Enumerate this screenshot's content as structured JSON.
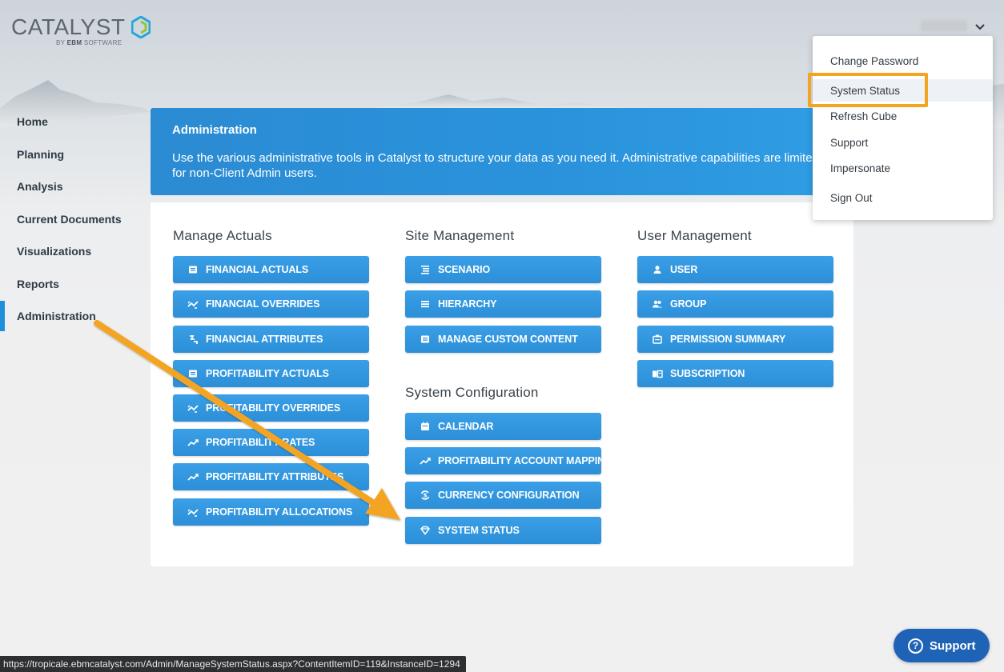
{
  "brand": {
    "name": "CATALYST",
    "byline_prefix": "BY",
    "byline_company": "EBM",
    "byline_suffix": "SOFTWARE",
    "accent": "#1f8fda"
  },
  "nav": {
    "items": [
      {
        "label": "Home"
      },
      {
        "label": "Planning"
      },
      {
        "label": "Analysis"
      },
      {
        "label": "Current Documents"
      },
      {
        "label": "Visualizations"
      },
      {
        "label": "Reports"
      },
      {
        "label": "Administration",
        "active": true
      }
    ]
  },
  "banner": {
    "title": "Administration",
    "description_line1": "Use the various administrative tools in Catalyst to structure your data as you need it. Administrative capabilities are limited",
    "description_line2": "for non-Client Admin users."
  },
  "sections": {
    "manage_actuals": {
      "title": "Manage Actuals",
      "buttons": [
        {
          "label": "FINANCIAL ACTUALS",
          "icon": "document-icon"
        },
        {
          "label": "FINANCIAL OVERRIDES",
          "icon": "trend-override-icon"
        },
        {
          "label": "FINANCIAL ATTRIBUTES",
          "icon": "attributes-icon"
        },
        {
          "label": "PROFITABILITY ACTUALS",
          "icon": "document-icon"
        },
        {
          "label": "PROFITABILITY OVERRIDES",
          "icon": "trend-override-icon"
        },
        {
          "label": "PROFITABILITY RATES",
          "icon": "trend-up-icon"
        },
        {
          "label": "PROFITABILITY ATTRIBUTES",
          "icon": "trend-up-icon"
        },
        {
          "label": "PROFITABILITY ALLOCATIONS",
          "icon": "trend-override-icon"
        }
      ]
    },
    "site_management": {
      "title": "Site Management",
      "buttons": [
        {
          "label": "SCENARIO",
          "icon": "scenario-icon"
        },
        {
          "label": "HIERARCHY",
          "icon": "list-icon"
        },
        {
          "label": "MANAGE CUSTOM CONTENT",
          "icon": "document-icon"
        }
      ]
    },
    "system_configuration": {
      "title": "System Configuration",
      "buttons": [
        {
          "label": "CALENDAR",
          "icon": "calendar-icon"
        },
        {
          "label": "PROFITABILITY ACCOUNT MAPPING",
          "icon": "trend-up-icon"
        },
        {
          "label": "CURRENCY CONFIGURATION",
          "icon": "currency-icon"
        },
        {
          "label": "SYSTEM STATUS",
          "icon": "diamond-icon"
        }
      ]
    },
    "user_management": {
      "title": "User Management",
      "buttons": [
        {
          "label": "USER",
          "icon": "user-icon"
        },
        {
          "label": "GROUP",
          "icon": "group-icon"
        },
        {
          "label": "PERMISSION SUMMARY",
          "icon": "permission-icon"
        },
        {
          "label": "SUBSCRIPTION",
          "icon": "subscription-icon"
        }
      ]
    }
  },
  "user_menu": {
    "items": [
      {
        "label": "Change Password"
      },
      {
        "label": "System Status",
        "highlighted": true
      },
      {
        "label": "Refresh Cube"
      },
      {
        "label": "Support"
      },
      {
        "label": "Impersonate"
      },
      {
        "label": "Sign Out"
      }
    ],
    "highlight_color": "#f3a421"
  },
  "status_bar": {
    "url": "https://tropicale.ebmcatalyst.com/Admin/ManageSystemStatus.aspx?ContentItemID=119&InstanceID=1294"
  },
  "support": {
    "label": "Support",
    "icon": "question-icon",
    "color": "#1f63b7"
  },
  "annotation": {
    "arrow_color": "#f3a421"
  }
}
